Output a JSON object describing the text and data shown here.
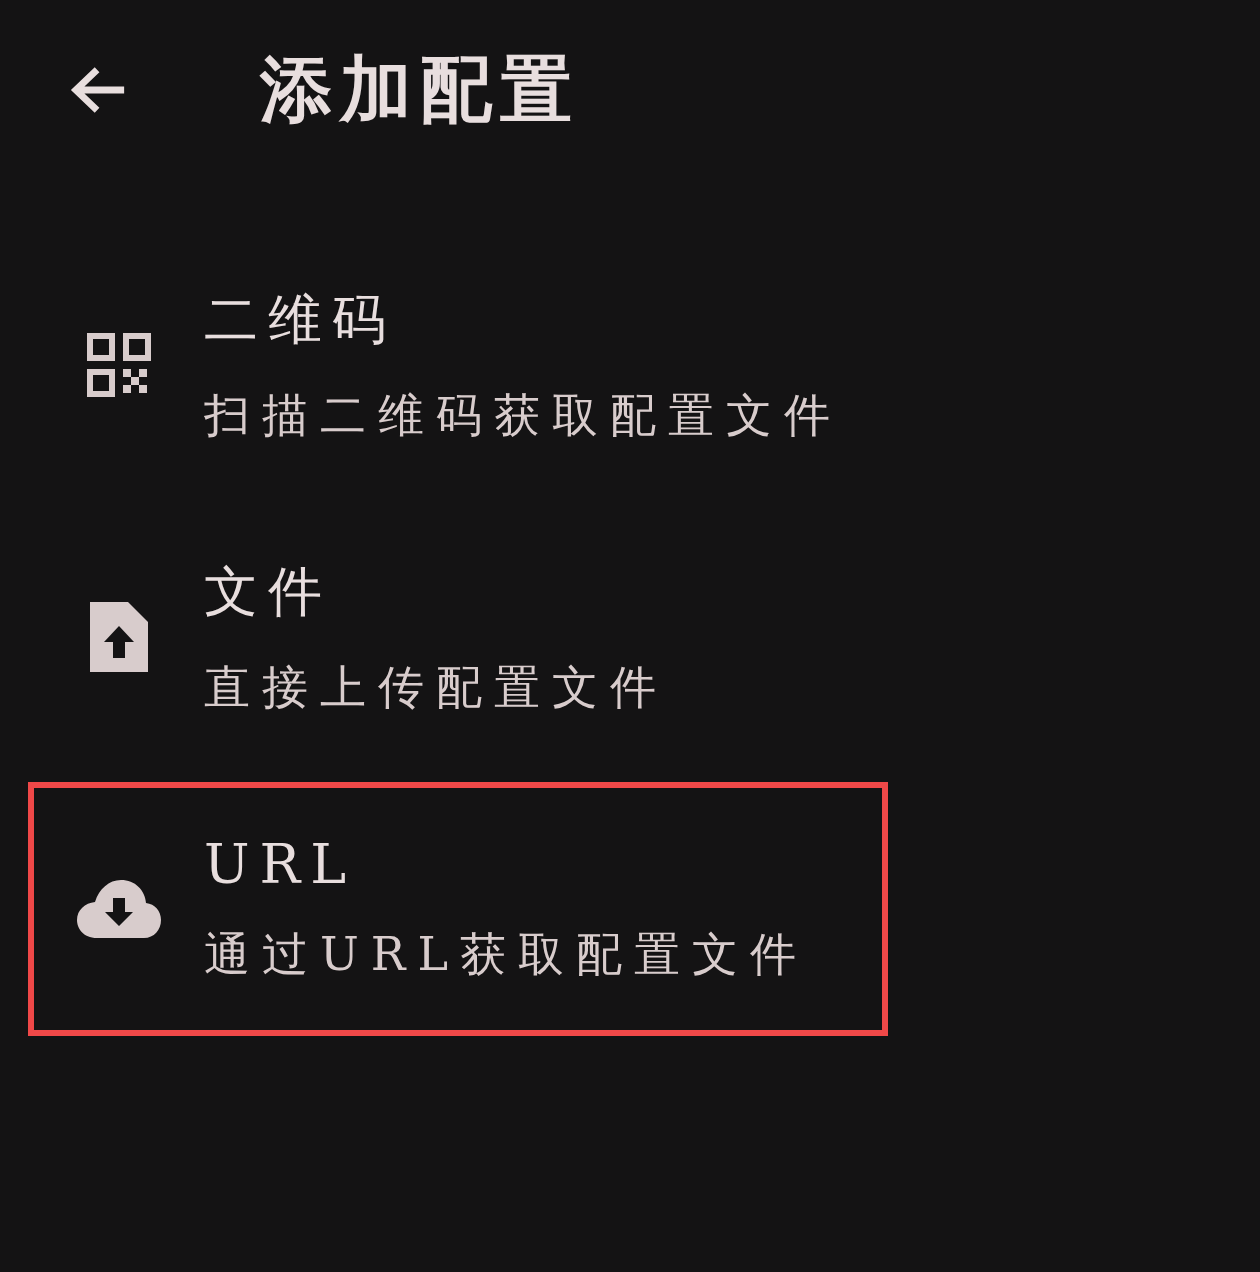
{
  "header": {
    "title": "添加配置"
  },
  "options": [
    {
      "kind": "qr",
      "title": "二维码",
      "subtitle": "扫描二维码获取配置文件",
      "highlighted": false
    },
    {
      "kind": "file",
      "title": "文件",
      "subtitle": "直接上传配置文件",
      "highlighted": false
    },
    {
      "kind": "url",
      "title": "URL",
      "subtitle": "通过URL获取配置文件",
      "highlighted": true
    }
  ]
}
